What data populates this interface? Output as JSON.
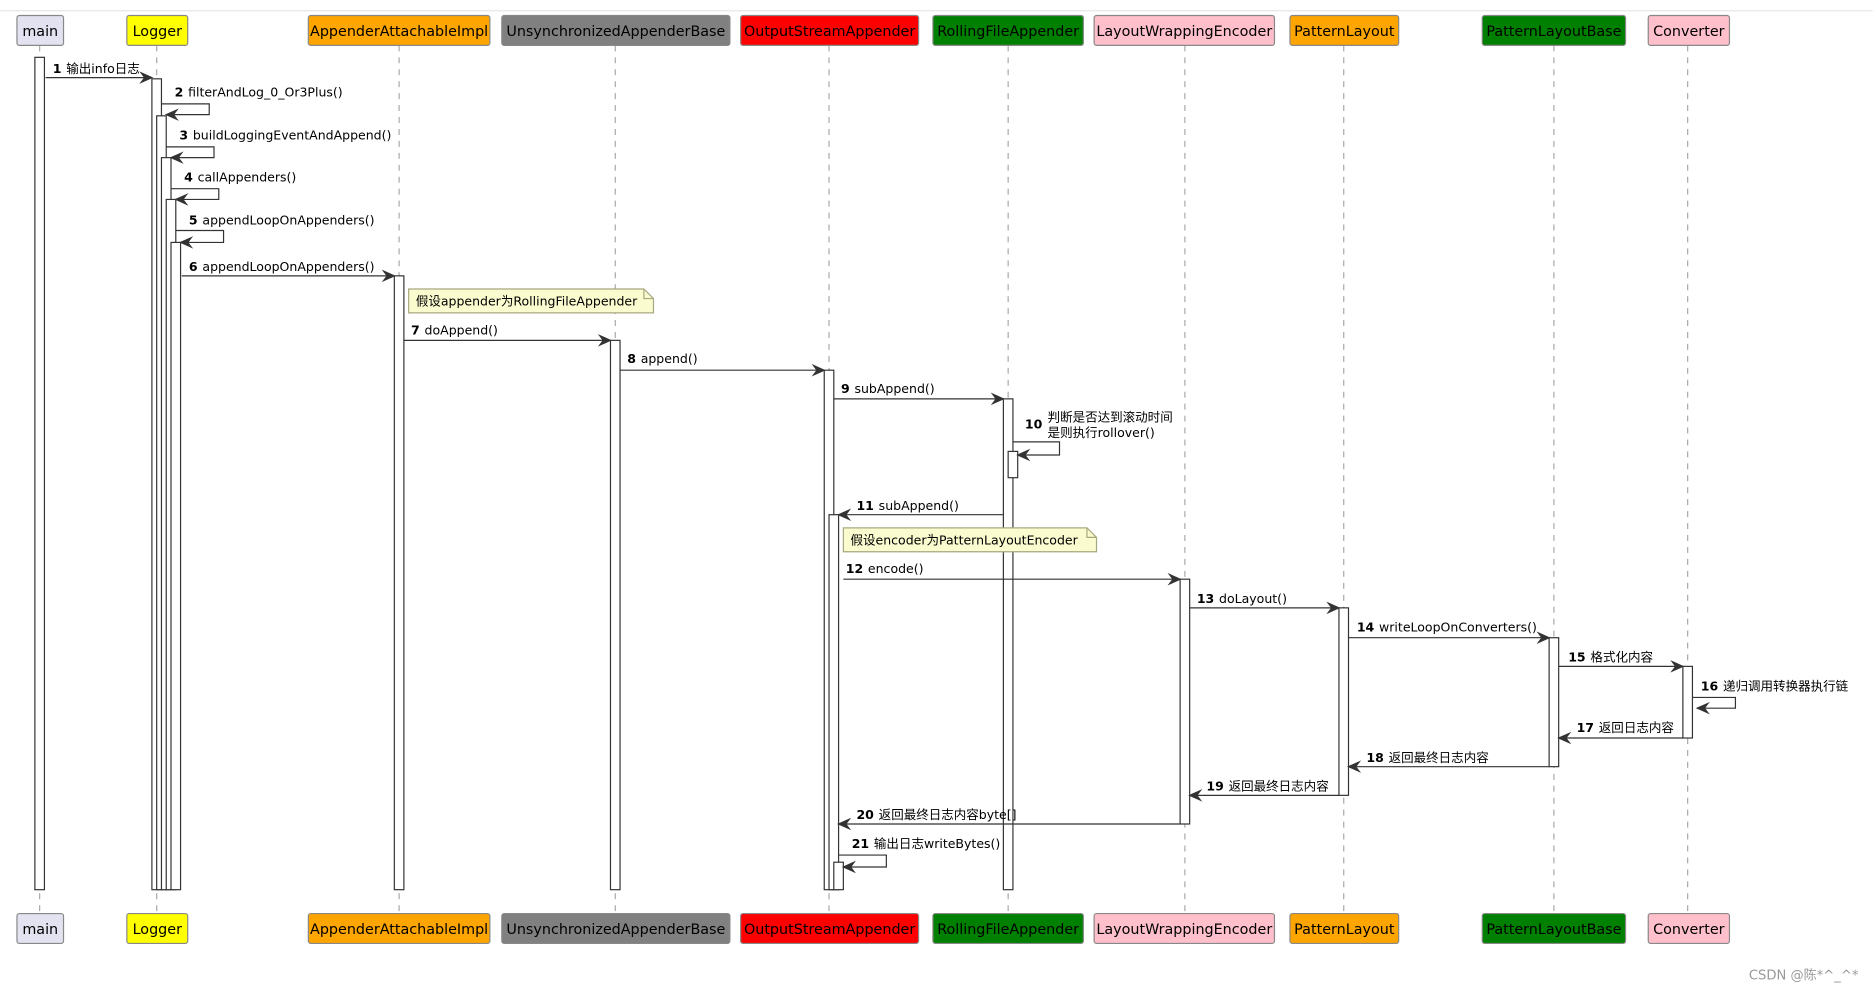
{
  "participants": [
    {
      "id": "main",
      "label": "main",
      "color": "#E2E2F0",
      "text_color": "#000000"
    },
    {
      "id": "logger",
      "label": "Logger",
      "color": "#FFFF00",
      "text_color": "#000000"
    },
    {
      "id": "aai",
      "label": "AppenderAttachableImpl",
      "color": "#FFA500",
      "text_color": "#000000"
    },
    {
      "id": "uab",
      "label": "UnsynchronizedAppenderBase",
      "color": "#808080",
      "text_color": "#000000"
    },
    {
      "id": "osa",
      "label": "OutputStreamAppender",
      "color": "#FF0000",
      "text_color": "#000000"
    },
    {
      "id": "rfa",
      "label": "RollingFileAppender",
      "color": "#008000",
      "text_color": "#000000"
    },
    {
      "id": "lwe",
      "label": "LayoutWrappingEncoder",
      "color": "#FFC0CB",
      "text_color": "#000000"
    },
    {
      "id": "pl",
      "label": "PatternLayout",
      "color": "#FFA500",
      "text_color": "#000000"
    },
    {
      "id": "plb",
      "label": "PatternLayoutBase",
      "color": "#008000",
      "text_color": "#000000"
    },
    {
      "id": "conv",
      "label": "Converter",
      "color": "#FFC0CB",
      "text_color": "#000000"
    }
  ],
  "messages": [
    {
      "num": "1",
      "text": "输出info日志",
      "from": "main",
      "to": "logger"
    },
    {
      "num": "2",
      "text": "filterAndLog_0_Or3Plus()",
      "from": "logger",
      "to": "logger"
    },
    {
      "num": "3",
      "text": "buildLoggingEventAndAppend()",
      "from": "logger",
      "to": "logger"
    },
    {
      "num": "4",
      "text": "callAppenders()",
      "from": "logger",
      "to": "logger"
    },
    {
      "num": "5",
      "text": "appendLoopOnAppenders()",
      "from": "logger",
      "to": "logger"
    },
    {
      "num": "6",
      "text": "appendLoopOnAppenders()",
      "from": "logger",
      "to": "aai"
    },
    {
      "num": "7",
      "text": "doAppend()",
      "from": "aai",
      "to": "uab"
    },
    {
      "num": "8",
      "text": "append()",
      "from": "uab",
      "to": "osa"
    },
    {
      "num": "9",
      "text": "subAppend()",
      "from": "osa",
      "to": "rfa"
    },
    {
      "num": "10",
      "text": "判断是否达到滚动时间",
      "text2": "是则执行rollover()",
      "from": "rfa",
      "to": "rfa"
    },
    {
      "num": "11",
      "text": "subAppend()",
      "from": "rfa",
      "to": "osa"
    },
    {
      "num": "12",
      "text": "encode()",
      "from": "osa",
      "to": "lwe"
    },
    {
      "num": "13",
      "text": "doLayout()",
      "from": "lwe",
      "to": "pl"
    },
    {
      "num": "14",
      "text": "writeLoopOnConverters()",
      "from": "pl",
      "to": "plb"
    },
    {
      "num": "15",
      "text": "格式化内容",
      "from": "plb",
      "to": "conv"
    },
    {
      "num": "16",
      "text": "递归调用转换器执行链",
      "from": "conv",
      "to": "conv"
    },
    {
      "num": "17",
      "text": "返回日志内容",
      "from": "conv",
      "to": "plb"
    },
    {
      "num": "18",
      "text": "返回最终日志内容",
      "from": "plb",
      "to": "pl"
    },
    {
      "num": "19",
      "text": "返回最终日志内容",
      "from": "pl",
      "to": "lwe"
    },
    {
      "num": "20",
      "text": "返回最终日志内容byte[]",
      "from": "lwe",
      "to": "osa"
    },
    {
      "num": "21",
      "text": "输出日志writeBytes()",
      "from": "osa",
      "to": "osa"
    }
  ],
  "notes": [
    {
      "text": "假设appender为RollingFileAppender",
      "over": "aai"
    },
    {
      "text": "假设encoder为PatternLayoutEncoder",
      "over": "osa"
    }
  ],
  "watermark": "CSDN @陈*^_^*"
}
